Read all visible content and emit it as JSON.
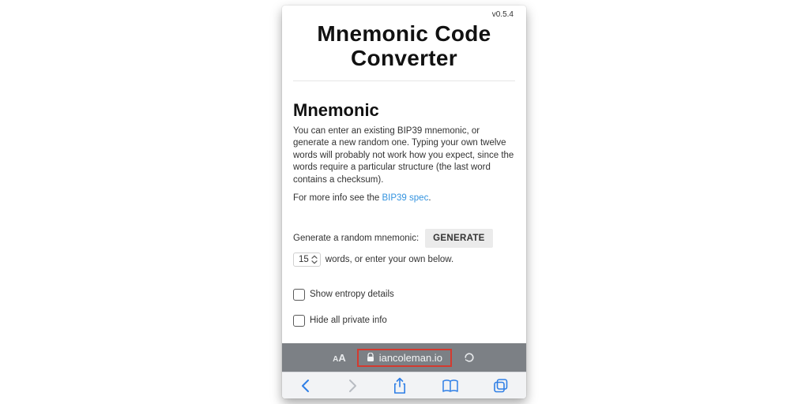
{
  "version": "v0.5.4",
  "title": "Mnemonic Code Converter",
  "section_heading": "Mnemonic",
  "intro": "You can enter an existing BIP39 mnemonic, or generate a new random one. Typing your own twelve words will probably not work how you expect, since the words require a particular structure (the last word contains a checksum).",
  "more_info_prefix": "For more info see the ",
  "more_info_link": "BIP39 spec",
  "more_info_suffix": ".",
  "generate": {
    "label": "Generate a random mnemonic:",
    "button": "GENERATE",
    "word_count": "15",
    "suffix": "words, or enter your own below."
  },
  "checkboxes": {
    "entropy": "Show entropy details",
    "hide": "Hide all private info"
  },
  "browser": {
    "aa": "AА",
    "url": "iancoleman.io"
  }
}
